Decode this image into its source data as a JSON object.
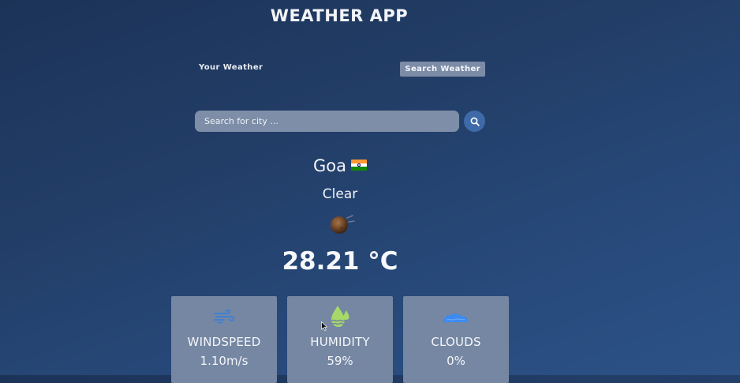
{
  "header": {
    "title": "WEATHER APP"
  },
  "tabs": {
    "your_weather": "Your Weather",
    "search_weather": "Search Weather"
  },
  "search": {
    "placeholder": "Search for city ...",
    "button_icon": "search-icon"
  },
  "weather": {
    "city": "Goa",
    "flag_icon": "india-flag-icon",
    "condition": "Clear",
    "condition_icon": "clear-night-icon",
    "temperature": "28.21 °C"
  },
  "cards": [
    {
      "label": "WINDSPEED",
      "value": "1.10m/s",
      "icon": "wind-icon"
    },
    {
      "label": "HUMIDITY",
      "value": "59%",
      "icon": "humidity-icon"
    },
    {
      "label": "CLOUDS",
      "value": "0%",
      "icon": "cloud-icon"
    }
  ],
  "colors": {
    "background_top": "#1c3358",
    "background_bottom": "#2c5286",
    "card_background": "#7587a2",
    "search_button": "#3e6aa8",
    "wind_icon": "#3b7fd6",
    "humidity_icon": "#a6d96a",
    "cloud_icon": "#3d8bf0"
  }
}
